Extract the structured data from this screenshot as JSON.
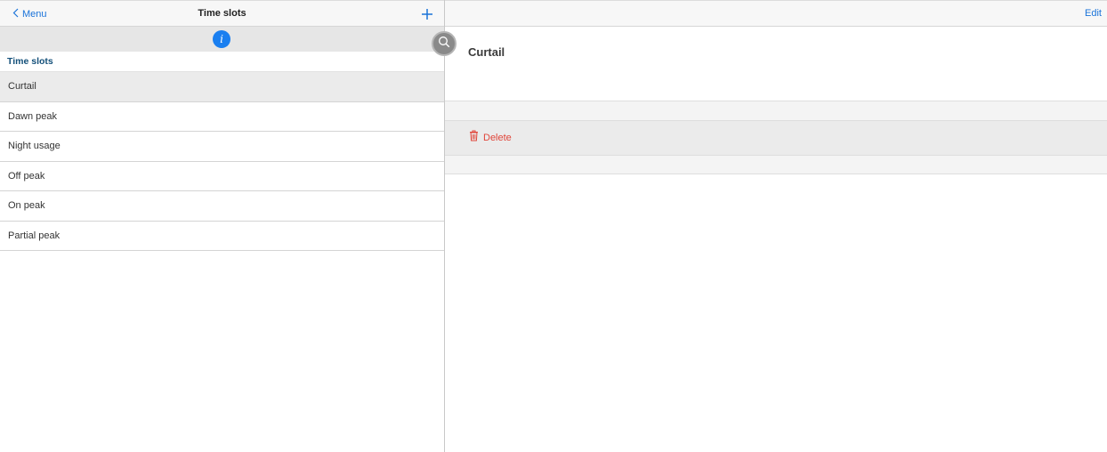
{
  "left_header": {
    "back_label": "Menu",
    "title": "Time slots"
  },
  "section": {
    "header": "Time slots"
  },
  "time_slots": [
    {
      "label": "Curtail",
      "selected": true
    },
    {
      "label": "Dawn peak",
      "selected": false
    },
    {
      "label": "Night usage",
      "selected": false
    },
    {
      "label": "Off peak",
      "selected": false
    },
    {
      "label": "On peak",
      "selected": false
    },
    {
      "label": "Partial peak",
      "selected": false
    }
  ],
  "detail": {
    "edit_label": "Edit",
    "title": "Curtail",
    "delete_label": "Delete"
  },
  "icons": {
    "back": "chevron-left-icon",
    "add": "plus-icon",
    "info": "info-icon",
    "search": "search-icon",
    "delete": "trash-icon"
  },
  "colors": {
    "accent": "#1a73d9",
    "info_badge": "#1a7ff0",
    "danger": "#e0453a",
    "section_header": "#14507a"
  }
}
